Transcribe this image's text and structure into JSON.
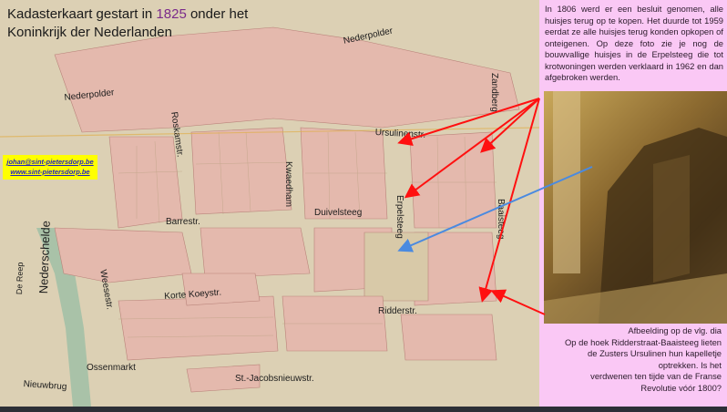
{
  "slide": {
    "title_line1_prefix": "Kadasterkaart gestart in ",
    "title_year": "1825",
    "title_line1_suffix": " onder het",
    "title_line2": "Koninkrijk der Nederlanden"
  },
  "contact": {
    "email": "johan@sint-pietersdorp.be",
    "website": "www.sint-pietersdorp.be"
  },
  "map_labels": {
    "nederpolder_top": "Nederpolder",
    "nederpolder_left": "Nederpolder",
    "roskamstr": "Roskamstr.",
    "ursulinenstr": "Ursulinenstr.",
    "zandberg": "Zandberg",
    "kwaedham": "Kwaedham",
    "duivelsteeg": "Duivelsteeg",
    "erpelsteeg": "Erpelsteeg",
    "baaisteeg": "Baaisteeg",
    "barrestr": "Barrestr.",
    "weesestr": "Weesestr.",
    "korte_koeystr": "Korte Koeystr.",
    "ridderstr": "Ridderstr.",
    "nederschelde": "Nederschelde",
    "de_reep": "De Reep",
    "ossenmarkt": "Ossenmarkt",
    "nieuwbrug": "Nieuwbrug",
    "st_jacobsnieuwstr": "St.-Jacobsnieuwstr."
  },
  "panel": {
    "top_text": "In 1806 werd er een besluit genomen, alle huisjes terug op te kopen. Het duurde tot 1959 eerdat ze alle huisjes terug konden opkopen of onteigenen. Op deze foto zie je nog de bouwvallige huisjes in de Erpelsteeg die tot krotwoningen werden verklaard in 1962 en dan afgebroken werden.",
    "bottom_lines": [
      "Afbeelding op de vlg. dia",
      "Op de hoek Ridderstraat-Baaisteeg lieten",
      "de Zusters Ursulinen hun kapelletje",
      "optrekken.  Is het",
      "verdwenen  ten tijde van de Franse",
      "Revolutie vóór 1800?"
    ]
  },
  "colors": {
    "panel": "#fac8f5",
    "map_bg": "#d9cdb0",
    "parcel": "#e6b8ae",
    "arrow_red": "#ff1010",
    "arrow_blue": "#4a8ae0",
    "contact_bg": "#ffff00"
  }
}
